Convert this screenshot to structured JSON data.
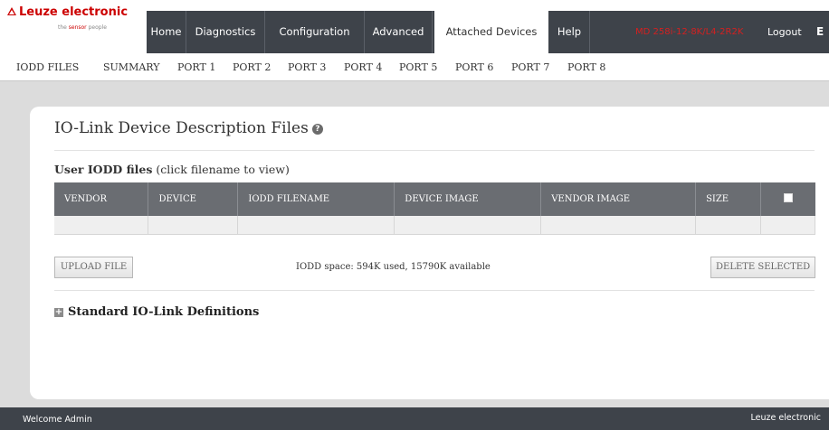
{
  "logo": {
    "name": "Leuze electronic",
    "tagline_pre": "the ",
    "tagline_accent": "sensor",
    "tagline_post": " people"
  },
  "nav": {
    "tabs": [
      {
        "label": "Home"
      },
      {
        "label": "Diagnostics"
      },
      {
        "label": "Configuration"
      },
      {
        "label": "Advanced"
      },
      {
        "label": "Attached Devices",
        "active": true
      },
      {
        "label": "Help"
      }
    ],
    "device_name": "MD 258i-12-8K/L4-2R2K",
    "logout_label": "Logout",
    "language": "E"
  },
  "subnav": {
    "items": [
      "IODD FILES",
      "SUMMARY",
      "PORT 1",
      "PORT 2",
      "PORT 3",
      "PORT 4",
      "PORT 5",
      "PORT 6",
      "PORT 7",
      "PORT 8"
    ]
  },
  "page": {
    "title": "IO-Link Device Description Files",
    "section_title_bold": "User IODD files",
    "section_title_note": "(click filename to view)",
    "table": {
      "columns": [
        "VENDOR",
        "DEVICE",
        "IODD FILENAME",
        "DEVICE IMAGE",
        "VENDOR IMAGE",
        "SIZE"
      ]
    },
    "upload_label": "UPLOAD FILE",
    "space_text": "IODD space: 594K used, 15790K available",
    "delete_label": "DELETE SELECTED",
    "standard_title": "Standard IO-Link Definitions"
  },
  "footer": {
    "welcome": "Welcome Admin",
    "brand": "Leuze electronic"
  },
  "colors": {
    "nav_bg": "#3e434a",
    "accent_red": "#cc0000",
    "table_header": "#6a6d72"
  }
}
